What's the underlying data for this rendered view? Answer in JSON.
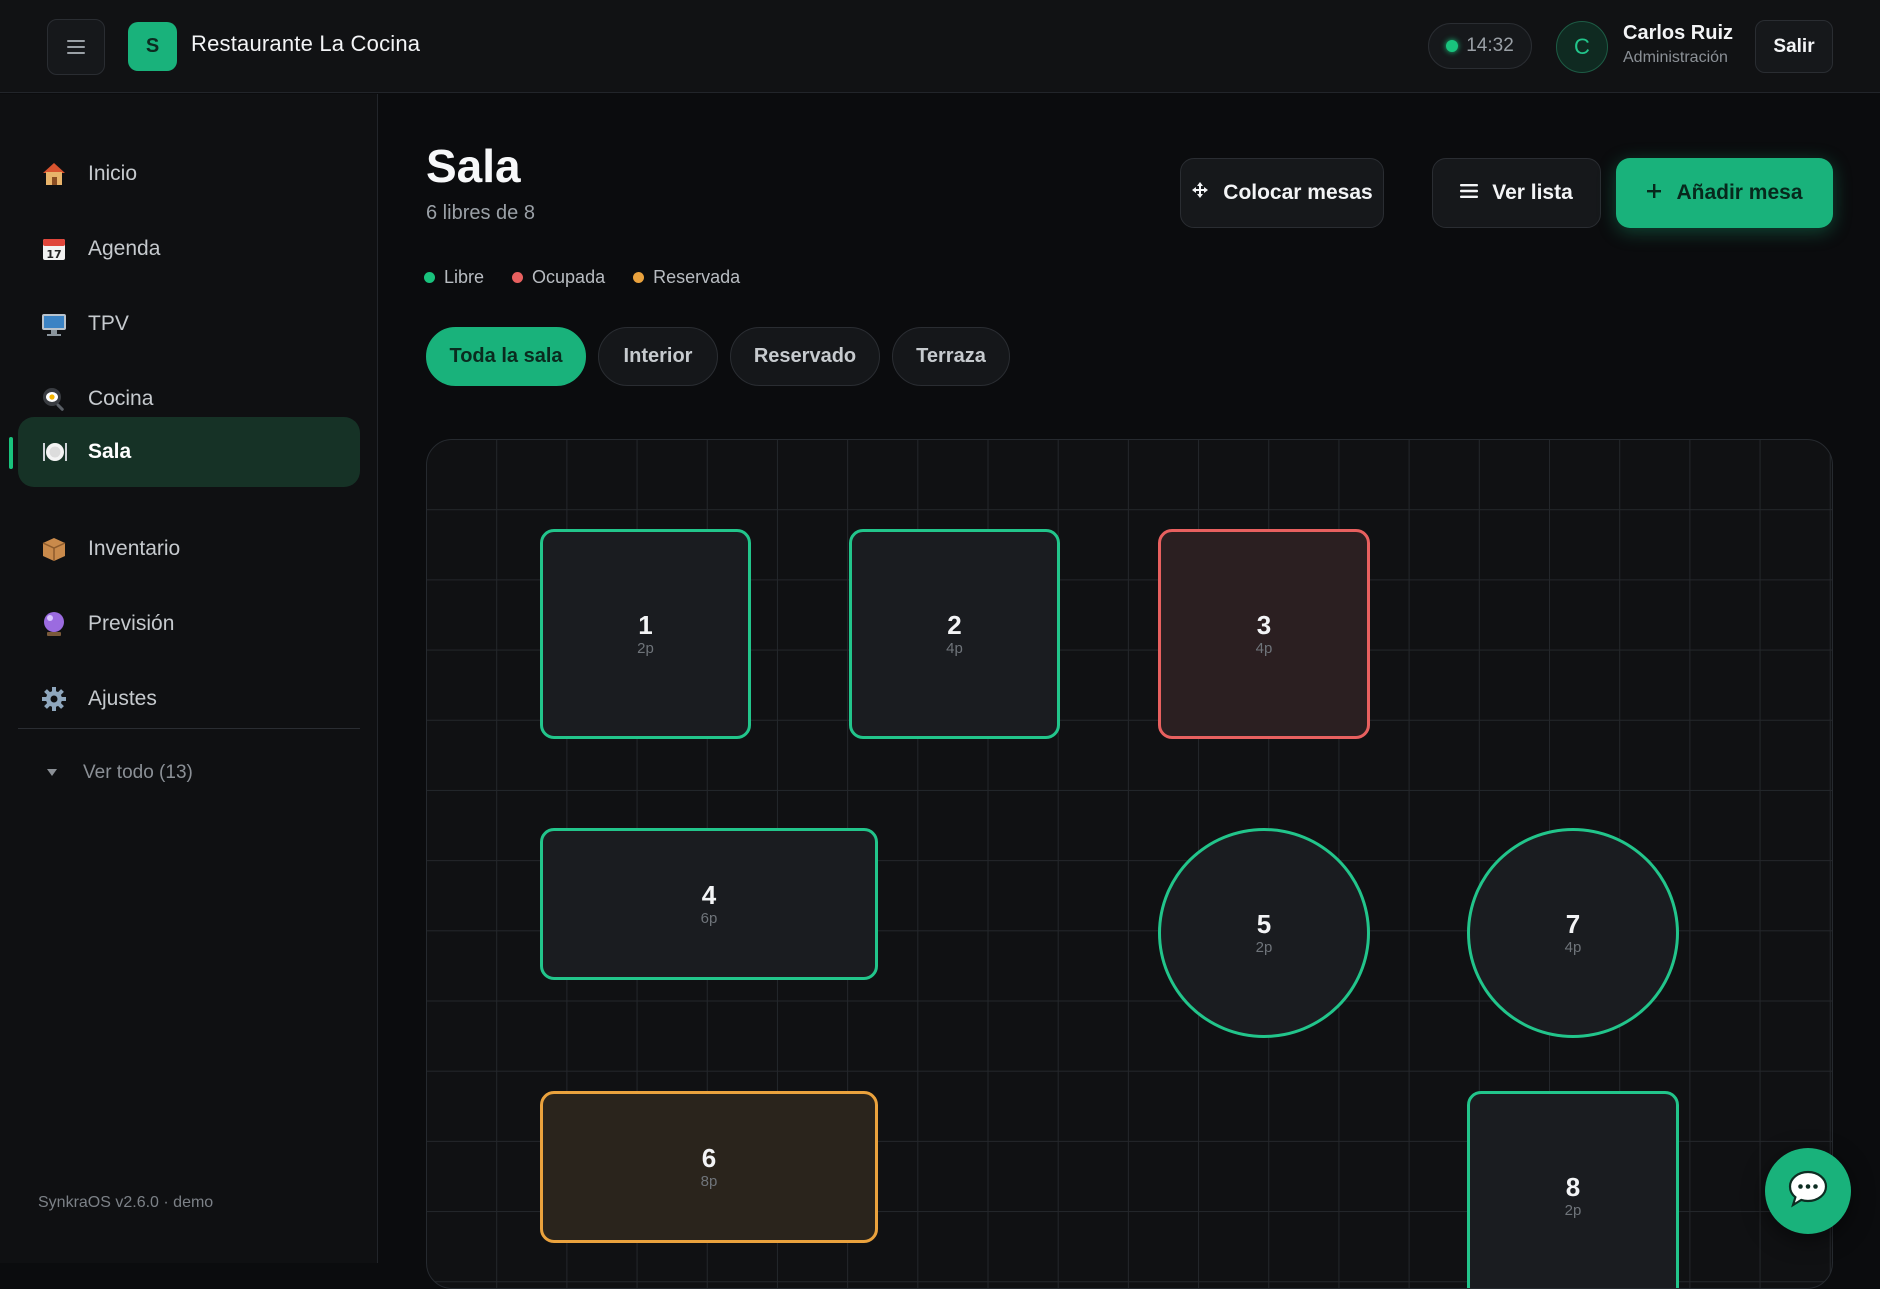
{
  "header": {
    "logo_letter": "S",
    "app_title": "Restaurante La Cocina",
    "clock": "14:32",
    "avatar_letter": "C",
    "user_name": "Carlos Ruiz",
    "user_role": "Administración",
    "logout_label": "Salir"
  },
  "sidebar": {
    "items": [
      {
        "label": "Inicio",
        "icon": "house-icon"
      },
      {
        "label": "Agenda",
        "icon": "calendar-icon"
      },
      {
        "label": "TPV",
        "icon": "monitor-icon"
      },
      {
        "label": "Cocina",
        "icon": "frying-pan-icon"
      },
      {
        "label": "Sala",
        "icon": "plate-cutlery-icon",
        "active": true
      },
      {
        "label": "Inventario",
        "icon": "package-icon"
      },
      {
        "label": "Previsión",
        "icon": "crystal-ball-icon"
      },
      {
        "label": "Ajustes",
        "icon": "gear-icon"
      }
    ],
    "more_label": "Ver todo (13)",
    "version": "SynkraOS v2.6.0 · demo"
  },
  "main": {
    "title": "Sala",
    "subtitle": "6 libres de 8",
    "toolbar": {
      "place_label": "Colocar mesas",
      "list_label": "Ver lista",
      "add_label": "Añadir mesa"
    },
    "legend": [
      {
        "label": "Libre",
        "color": "#19c37d"
      },
      {
        "label": "Ocupada",
        "color": "#e8605f"
      },
      {
        "label": "Reservada",
        "color": "#eaa23d"
      }
    ],
    "filters": [
      {
        "label": "Toda la sala",
        "active": true
      },
      {
        "label": "Interior"
      },
      {
        "label": "Reservado"
      },
      {
        "label": "Terraza"
      }
    ],
    "tables": [
      {
        "number": "1",
        "capacity": "2p",
        "status": "libre",
        "shape": "square"
      },
      {
        "number": "2",
        "capacity": "4p",
        "status": "libre",
        "shape": "square"
      },
      {
        "number": "3",
        "capacity": "4p",
        "status": "ocupada",
        "shape": "square"
      },
      {
        "number": "4",
        "capacity": "6p",
        "status": "libre",
        "shape": "rect"
      },
      {
        "number": "5",
        "capacity": "2p",
        "status": "libre",
        "shape": "round"
      },
      {
        "number": "7",
        "capacity": "4p",
        "status": "libre",
        "shape": "round"
      },
      {
        "number": "6",
        "capacity": "8p",
        "status": "reservada",
        "shape": "rect"
      },
      {
        "number": "8",
        "capacity": "2p",
        "status": "libre",
        "shape": "square"
      }
    ]
  },
  "colors": {
    "accent": "#19b27b",
    "free": "#22c58b",
    "occupied": "#e8605f",
    "reserved": "#eaa23d"
  }
}
